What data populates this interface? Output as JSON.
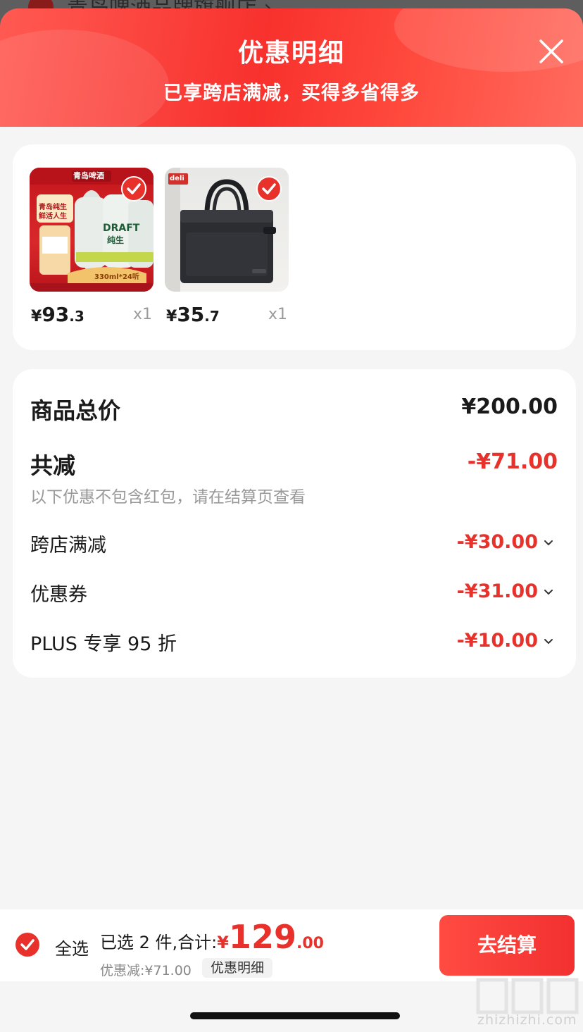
{
  "underlying_page": {
    "store_name": "青岛啤酒品牌旗舰店 ›"
  },
  "sheet": {
    "title": "优惠明细",
    "subtitle": "已享跨店满减，买得多省得多"
  },
  "colors": {
    "accent_red": "#e9312b",
    "header_gradient_start": "#ff5a52",
    "header_gradient_end": "#ff6b5e"
  },
  "products": [
    {
      "brand": "青岛啤酒",
      "badge_line1": "青岛纯生",
      "badge_line2": "鲜活人生",
      "can_text": "DRAFT",
      "can_text_cn": "纯生",
      "spec": "330ml*24听",
      "price_symbol": "¥",
      "price_int": "93",
      "price_dec": ".3",
      "quantity": "x1",
      "selected": true,
      "image_icon": "beer-cans-icon"
    },
    {
      "brand": "deli",
      "price_symbol": "¥",
      "price_int": "35",
      "price_dec": ".7",
      "quantity": "x1",
      "selected": true,
      "image_icon": "briefcase-bag-icon"
    }
  ],
  "summary": {
    "total_label": "商品总价",
    "total_value": "¥200.00",
    "reduce_label": "共减",
    "reduce_value": "-¥71.00",
    "note": "以下优惠不包含红包，请在结算页查看",
    "discounts": [
      {
        "label": "跨店满减",
        "value": "-¥30.00"
      },
      {
        "label": "优惠券",
        "value": "-¥31.00"
      },
      {
        "label": "PLUS 专享 95 折",
        "value": "-¥10.00"
      }
    ]
  },
  "bottom_bar": {
    "select_all_label": "全选",
    "selected_text": "已选 2 件,合计:",
    "total_symbol": "¥",
    "total_int": "129",
    "total_dec": ".00",
    "discount_text": "优惠减:¥71.00",
    "detail_button": "优惠明细",
    "checkout_button": "去结算"
  },
  "watermark": {
    "logo_text": "值值值",
    "site": "zhizhizhi.com"
  }
}
